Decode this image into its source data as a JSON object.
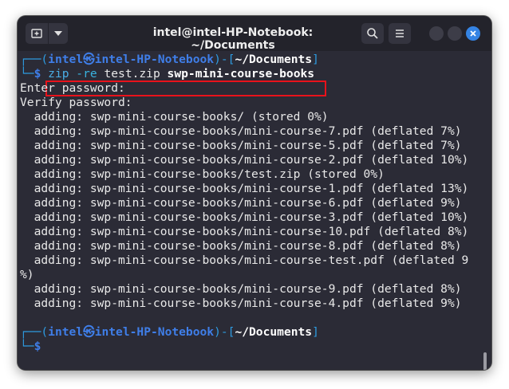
{
  "window": {
    "title": "intel@intel-HP-Notebook: ~/Documents"
  },
  "icons": {
    "new_tab": "new-tab-icon",
    "dropdown": "chevron-down-icon",
    "search": "search-icon",
    "menu": "hamburger-menu-icon",
    "close": "close-icon"
  },
  "colors": {
    "accent": "#3584e4",
    "highlight_box": "#e8121b",
    "prompt_user": "#3f7ee8"
  },
  "prompt1": {
    "box_top": "┌──(",
    "user": "intel",
    "at": "㉿",
    "host": "intel-HP-Notebook",
    "sep": ")-[",
    "dir": "~/Documents",
    "close": "]",
    "box_bottom": "└─",
    "dollar": "$ ",
    "cmd": "zip",
    "flag": " -re",
    "arg1": " test.zip ",
    "arg2": "swp-mini-course-books"
  },
  "output": [
    "Enter password:",
    "Verify password:",
    "  adding: swp-mini-course-books/ (stored 0%)",
    "  adding: swp-mini-course-books/mini-course-7.pdf (deflated 7%)",
    "  adding: swp-mini-course-books/mini-course-5.pdf (deflated 7%)",
    "  adding: swp-mini-course-books/mini-course-2.pdf (deflated 10%)",
    "  adding: swp-mini-course-books/test.zip (stored 0%)",
    "  adding: swp-mini-course-books/mini-course-1.pdf (deflated 13%)",
    "  adding: swp-mini-course-books/mini-course-6.pdf (deflated 9%)",
    "  adding: swp-mini-course-books/mini-course-3.pdf (deflated 10%)",
    "  adding: swp-mini-course-books/mini-course-10.pdf (deflated 8%)",
    "  adding: swp-mini-course-books/mini-course-8.pdf (deflated 8%)",
    "  adding: swp-mini-course-books/mini-course-test.pdf (deflated 9",
    "%)",
    "  adding: swp-mini-course-books/mini-course-9.pdf (deflated 8%)",
    "  adding: swp-mini-course-books/mini-course-4.pdf (deflated 9%)"
  ],
  "prompt2": {
    "box_top": "┌──(",
    "user": "intel",
    "at": "㉿",
    "host": "intel-HP-Notebook",
    "sep": ")-[",
    "dir": "~/Documents",
    "close": "]",
    "box_bottom": "└─",
    "dollar": "$"
  }
}
